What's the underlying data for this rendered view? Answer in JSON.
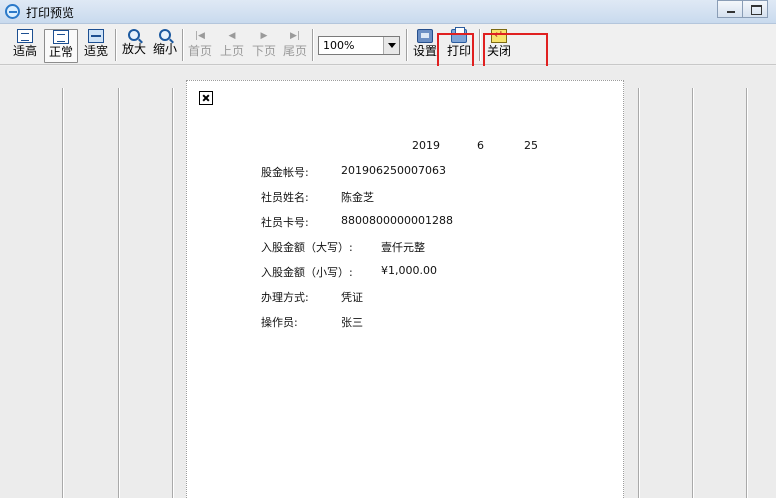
{
  "window": {
    "title": "打印预览"
  },
  "toolbar": {
    "fit_height": "适高",
    "normal": "正常",
    "fit_width": "适宽",
    "zoom_in": "放大",
    "zoom_out": "缩小",
    "first_page": "首页",
    "prev_page": "上页",
    "next_page": "下页",
    "last_page": "尾页",
    "zoom_value": "100%",
    "settings": "设置",
    "print": "打印",
    "close": "关闭"
  },
  "receipt": {
    "year": "2019",
    "month": "6",
    "day": "25",
    "rows": [
      {
        "label": "股金帐号:",
        "value": "201906250007063"
      },
      {
        "label": "社员姓名:",
        "value": "陈金芝"
      },
      {
        "label": "社员卡号:",
        "value": "8800800000001288"
      },
      {
        "label": "入股金额（大写）:",
        "value": "壹仟元整"
      },
      {
        "label": "入股金额（小写）:",
        "value": "¥1,000.00"
      },
      {
        "label": "办理方式:",
        "value": "凭证"
      },
      {
        "label": "操作员:",
        "value": "张三"
      }
    ]
  },
  "colors": {
    "annotation_box": "#e02020"
  }
}
